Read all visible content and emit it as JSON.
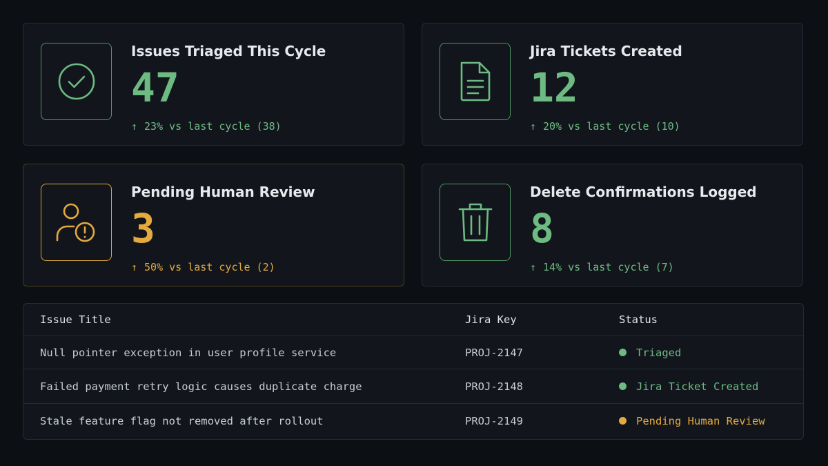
{
  "colors": {
    "green": "#6dbb82",
    "amber": "#e5aa3e",
    "background": "#0c0f14",
    "card": "#12161c"
  },
  "cards": [
    {
      "title": "Issues Triaged This Cycle",
      "value": "47",
      "delta": "23% vs last cycle (38)",
      "arrow": "↑",
      "icon": "check-circle-icon",
      "tone": "green"
    },
    {
      "title": "Jira Tickets Created",
      "value": "12",
      "delta": "20% vs last cycle (10)",
      "arrow": "↑",
      "icon": "document-icon",
      "tone": "green"
    },
    {
      "title": "Pending Human Review",
      "value": "3",
      "delta": "50% vs last cycle (2)",
      "arrow": "↑",
      "icon": "user-alert-icon",
      "tone": "amber"
    },
    {
      "title": "Delete Confirmations Logged",
      "value": "8",
      "delta": "14% vs last cycle (7)",
      "arrow": "↑",
      "icon": "trash-icon",
      "tone": "green"
    }
  ],
  "table": {
    "headers": [
      "Issue Title",
      "Jira Key",
      "Status"
    ],
    "rows": [
      {
        "title": "Null pointer exception in user profile service",
        "key": "PROJ-2147",
        "status": "Triaged",
        "tone": "green"
      },
      {
        "title": "Failed payment retry logic causes duplicate charge",
        "key": "PROJ-2148",
        "status": "Jira Ticket Created",
        "tone": "green"
      },
      {
        "title": "Stale feature flag not removed after rollout",
        "key": "PROJ-2149",
        "status": "Pending Human Review",
        "tone": "amber"
      }
    ]
  }
}
